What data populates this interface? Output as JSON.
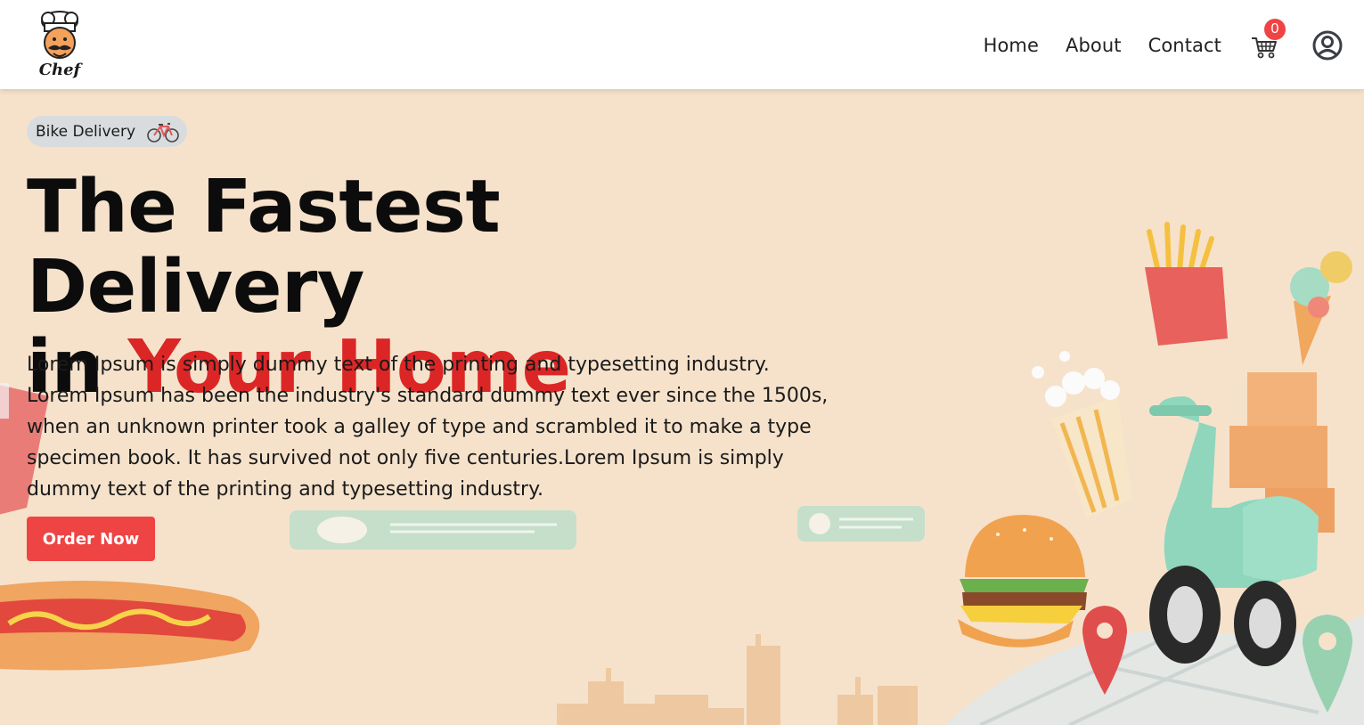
{
  "header": {
    "logo_text": "Chef",
    "nav": [
      {
        "label": "Home"
      },
      {
        "label": "About"
      },
      {
        "label": "Contact"
      }
    ],
    "cart_count": "0",
    "icons": {
      "cart": "cart-icon",
      "user": "user-circle-icon"
    }
  },
  "hero": {
    "pill_label": "Bike Delivery",
    "headline_line1": "The Fastest Delivery",
    "headline_in": "in ",
    "headline_accent": "Your Home",
    "paragraph": "Lorem Ipsum is simply dummy text of the printing and typesetting industry. Lorem Ipsum has been the industry's standard dummy text ever since the 1500s, when an unknown printer took a galley of type and scrambled it to make a type specimen book. It has survived not only five centuries.Lorem Ipsum is simply dummy text of the printing and typesetting industry.",
    "cta_label": "Order Now"
  },
  "colors": {
    "hero_bg": "#f6e2cb",
    "accent": "#dc2626",
    "button": "#ef4444",
    "badge": "#ef4444"
  }
}
